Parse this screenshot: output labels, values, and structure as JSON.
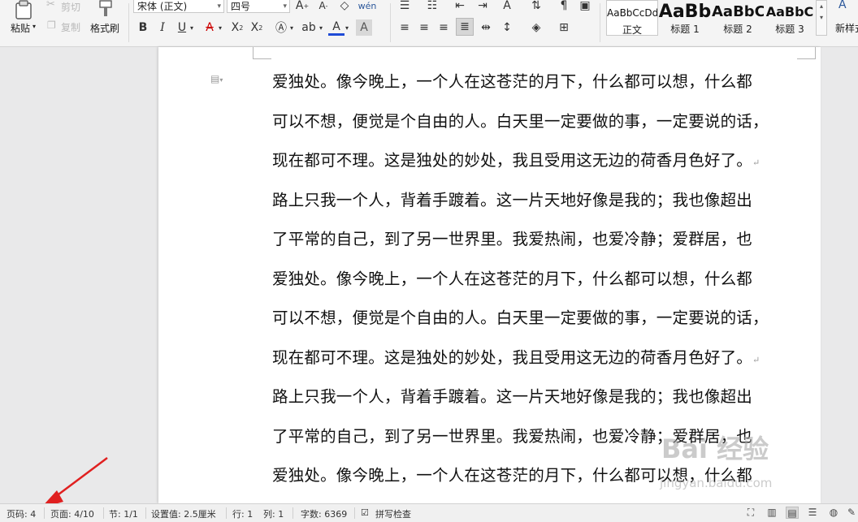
{
  "ribbon": {
    "clipboard": {
      "paste": "粘贴",
      "cut": "剪切",
      "copy": "复制",
      "format_painter": "格式刷"
    },
    "font": {
      "name": "宋体 (正文)",
      "size": "四号"
    },
    "styles": [
      {
        "preview": "AaBbCcDd",
        "name": "正文"
      },
      {
        "preview": "AaBb",
        "name": "标题 1"
      },
      {
        "preview": "AaBbC",
        "name": "标题 2"
      },
      {
        "preview": "AaBbC",
        "name": "标题 3"
      }
    ],
    "new_style": "新样式"
  },
  "document": {
    "lines": [
      "爱独处。像今晚上，一个人在这苍茫的月下，什么都可以想，什么都",
      "可以不想，便觉是个自由的人。白天里一定要做的事，一定要说的话，",
      "现在都可不理。这是独处的妙处，我且受用这无边的荷香月色好了。",
      "路上只我一个人，背着手踱着。这一片天地好像是我的；我也像超出",
      "了平常的自己，到了另一世界里。我爱热闹，也爱冷静；爱群居，也",
      "爱独处。像今晚上，一个人在这苍茫的月下，什么都可以想，什么都",
      "可以不想，便觉是个自由的人。白天里一定要做的事，一定要说的话，",
      "现在都可不理。这是独处的妙处，我且受用这无边的荷香月色好了。",
      "路上只我一个人，背着手踱着。这一片天地好像是我的；我也像超出",
      "了平常的自己，到了另一世界里。我爱热闹，也爱冷静；爱群居，也",
      "爱独处。像今晚上，一个人在这苍茫的月下，什么都可以想，什么都"
    ],
    "para_mark": "↵"
  },
  "status": {
    "page_no": "页码: 4",
    "page": "页面: 4/10",
    "section": "节: 1/1",
    "setting": "设置值: 2.5厘米",
    "row": "行: 1",
    "col": "列: 1",
    "word_count": "字数: 6369",
    "spell_check": "拼写检查"
  },
  "watermark": {
    "brand": "Bai 经验",
    "url": "jingyan.baidu.com"
  },
  "colors": {
    "accent": "#2b579a",
    "arrow": "#e02020",
    "font_color_bar": "#1f4bd6"
  }
}
